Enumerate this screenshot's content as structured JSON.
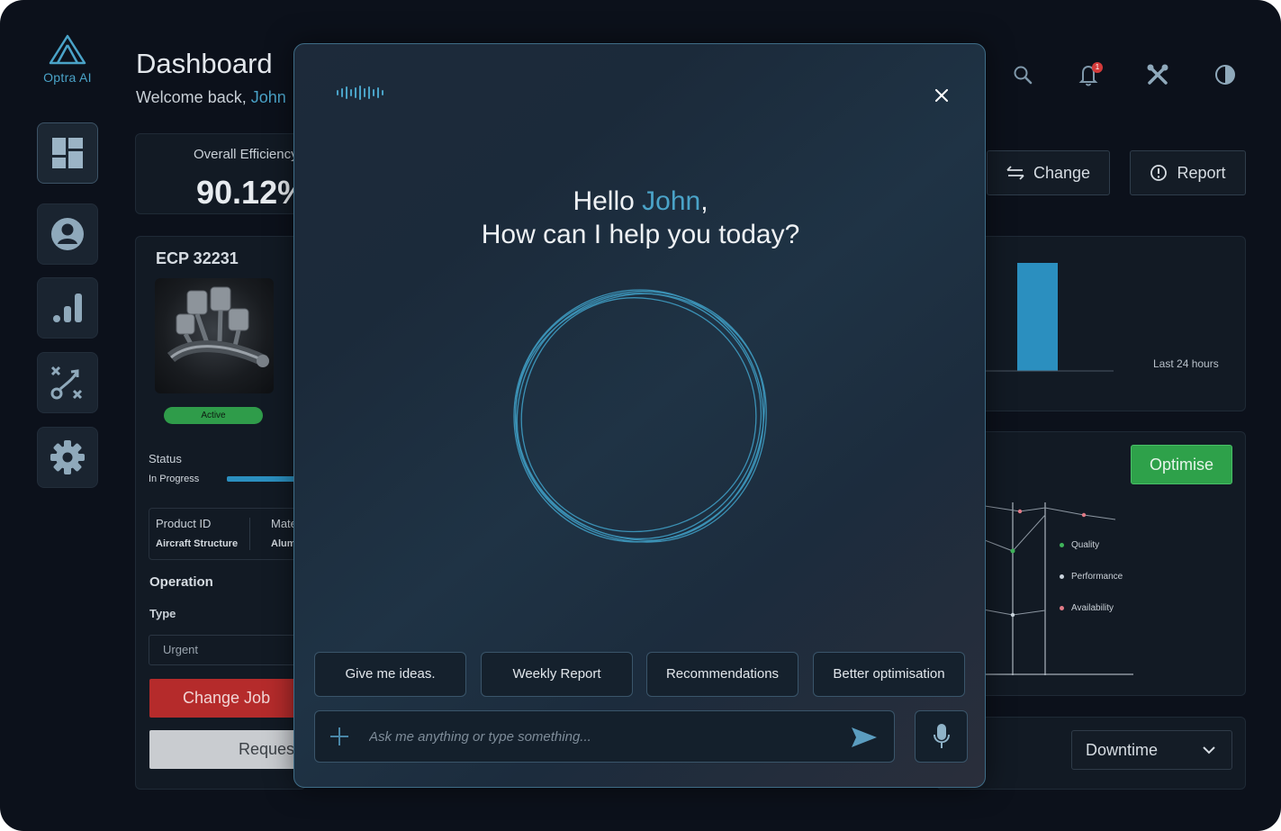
{
  "app": {
    "name": "Optra AI"
  },
  "header": {
    "title": "Dashboard",
    "welcome_prefix": "Welcome back,",
    "user_name": "John",
    "notification_count": "1"
  },
  "actions": {
    "change_label": "Change",
    "report_label": "Report"
  },
  "efficiency": {
    "label": "Overall Efficiency",
    "value": "90.12%"
  },
  "job": {
    "id": "ECP 32231",
    "badge": "Active",
    "status_label": "Status",
    "status_value": "In Progress",
    "product_id_label": "Product ID",
    "product_id_value": "Aircraft Structure",
    "material_label": "Material",
    "material_value": "Aluminium",
    "operation_label": "Operation",
    "type_label": "Type",
    "type_value": "Urgent",
    "change_job_label": "Change Job",
    "request_label": "Request"
  },
  "chart_top": {
    "period_label": "Last 24 hours",
    "accent_color": "#2b8fbf"
  },
  "chart_oee": {
    "optimise_label": "Optimise",
    "legend": [
      {
        "label": "Quality",
        "color": "#3fb45a"
      },
      {
        "label": "Performance",
        "color": "#c9d3dc"
      },
      {
        "label": "Availability",
        "color": "#e07a86"
      }
    ]
  },
  "downtime": {
    "label": "Downtime"
  },
  "assistant": {
    "greeting_hello": "Hello",
    "greeting_name": "John",
    "greeting_comma": ",",
    "greeting_line2": "How can I help you today?",
    "chips": [
      "Give me ideas.",
      "Weekly Report",
      "Recommendations",
      "Better optimisation"
    ],
    "input_placeholder": "Ask me anything or type something...",
    "icons": [
      "voice-wave-icon",
      "close-icon",
      "plus-icon",
      "send-icon",
      "microphone-icon"
    ]
  }
}
